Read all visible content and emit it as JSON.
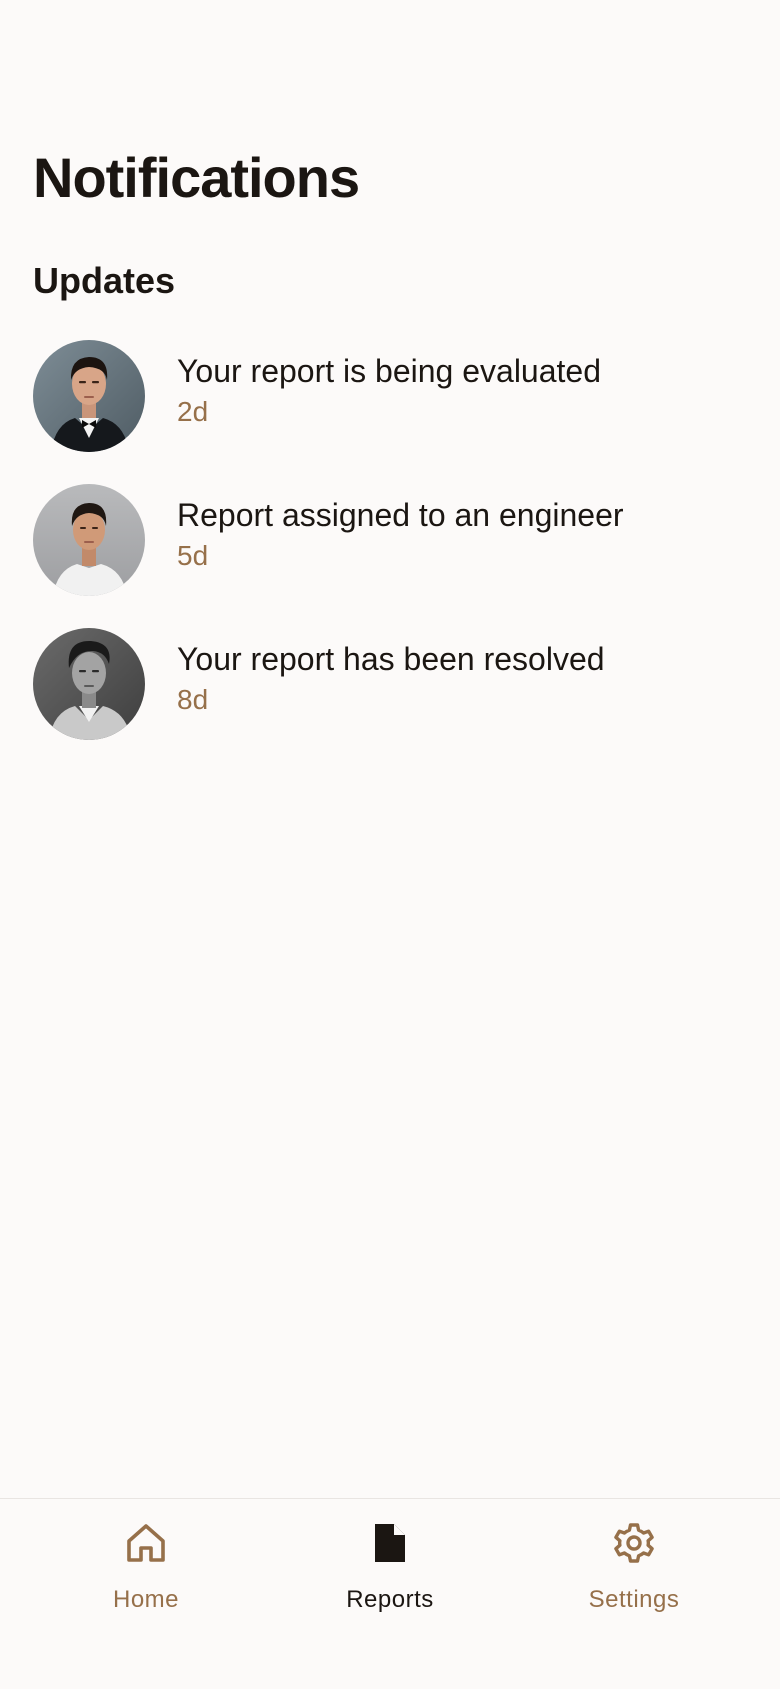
{
  "header": {
    "title": "Notifications"
  },
  "section": {
    "title": "Updates"
  },
  "notifications": [
    {
      "title": "Your report is being evaluated",
      "time": "2d",
      "avatar": "person-avatar-1"
    },
    {
      "title": "Report assigned to an engineer",
      "time": "5d",
      "avatar": "person-avatar-2"
    },
    {
      "title": "Your report has been resolved",
      "time": "8d",
      "avatar": "person-avatar-3"
    }
  ],
  "nav": {
    "items": [
      {
        "label": "Home",
        "icon": "home-icon",
        "active": false
      },
      {
        "label": "Reports",
        "icon": "document-icon",
        "active": true
      },
      {
        "label": "Settings",
        "icon": "gear-icon",
        "active": false
      }
    ]
  },
  "colors": {
    "background": "#fcfaf9",
    "text": "#1b1612",
    "accent": "#96704a",
    "divider": "#e9e5e2"
  }
}
